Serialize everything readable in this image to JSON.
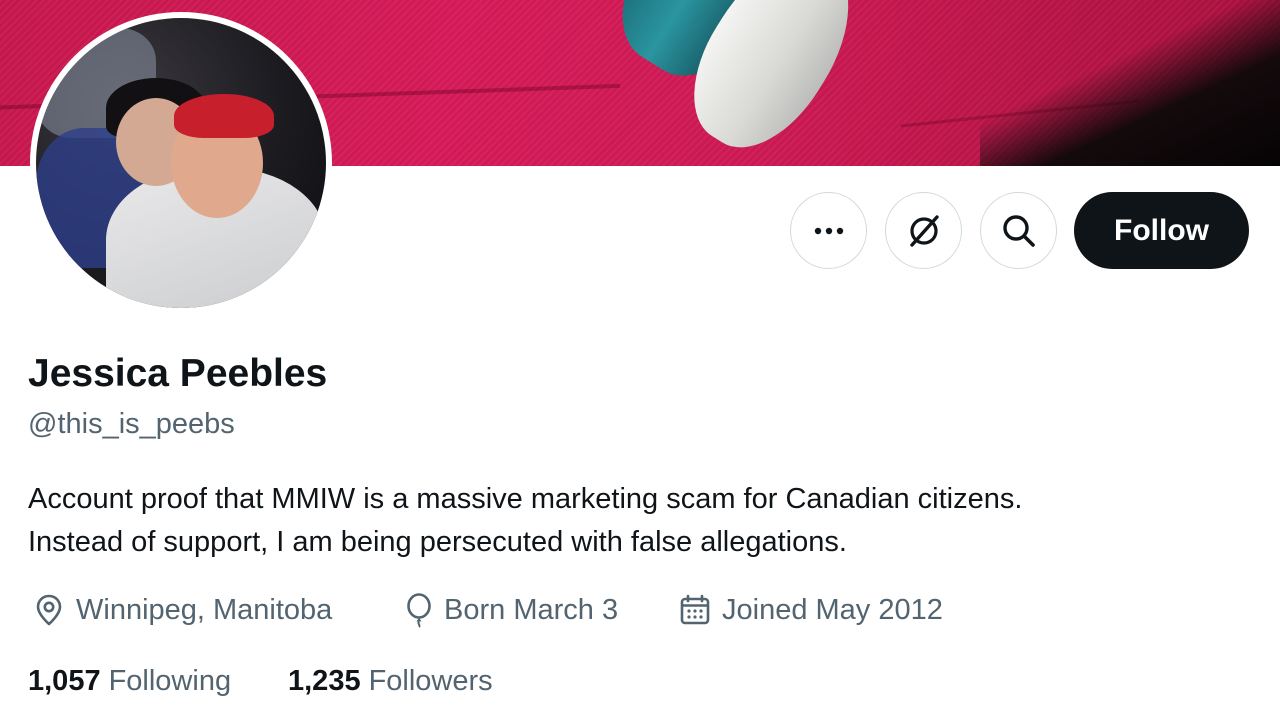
{
  "profile": {
    "display_name": "Jessica Peebles",
    "handle": "@this_is_peebs",
    "bio_lines": [
      "Account proof that MMIW is a massive marketing scam for Canadian citizens.",
      "Instead of support, I am being persecuted with false allegations."
    ],
    "location": "Winnipeg, Manitoba",
    "birthday": "Born March 3",
    "joined": "Joined May 2012",
    "following_count": "1,057",
    "following_label": "Following",
    "followers_count": "1,235",
    "followers_label": "Followers"
  },
  "actions": {
    "follow_label": "Follow",
    "icons": [
      "more-icon",
      "grok-icon",
      "search-icon"
    ]
  },
  "colors": {
    "text_primary": "#0f1419",
    "text_secondary": "#536471",
    "button_dark": "#0f1419",
    "border": "#cfd9de",
    "banner_red": "#d81b5a"
  }
}
